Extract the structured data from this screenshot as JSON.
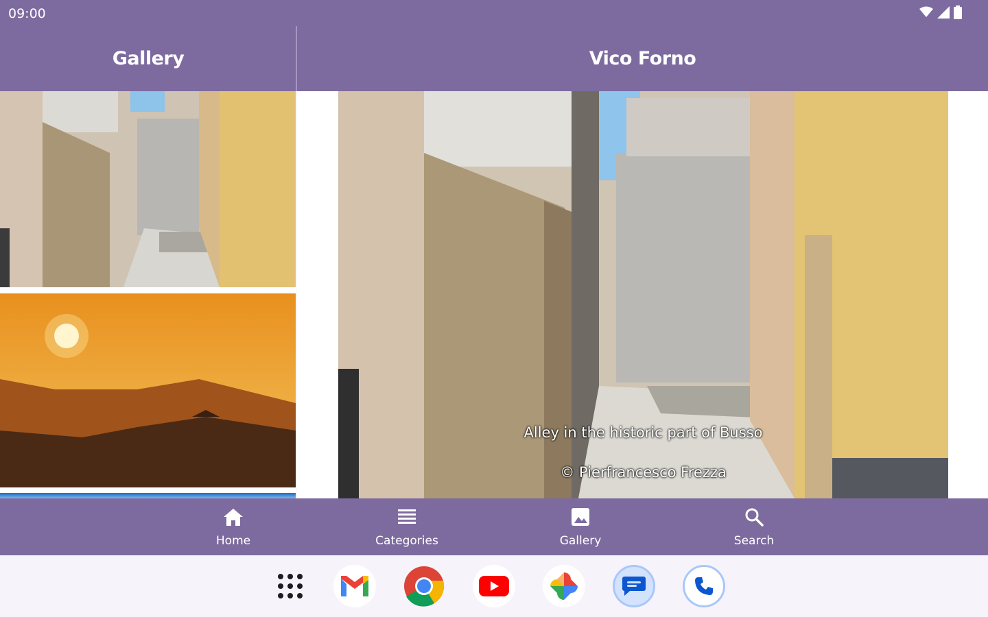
{
  "status": {
    "time": "09:00",
    "icons": [
      "wifi-icon",
      "cell-signal-icon",
      "battery-icon"
    ]
  },
  "list_header": {
    "title": "Gallery"
  },
  "detail_header": {
    "title": "Vico Forno"
  },
  "gallery": {
    "items": [
      {
        "name": "alley-thumbnail"
      },
      {
        "name": "sunset-thumbnail"
      },
      {
        "name": "sky-thumbnail"
      }
    ]
  },
  "detail": {
    "caption": "Alley in the historic part of Busso",
    "credit": "© Pierfrancesco Frezza"
  },
  "bottom_nav": {
    "items": [
      {
        "label": "Home",
        "icon": "home-icon"
      },
      {
        "label": "Categories",
        "icon": "list-icon"
      },
      {
        "label": "Gallery",
        "icon": "image-icon"
      },
      {
        "label": "Search",
        "icon": "search-icon"
      }
    ]
  },
  "dock": {
    "apps": [
      "app-drawer",
      "gmail",
      "chrome",
      "youtube",
      "photos",
      "messages",
      "phone"
    ]
  },
  "colors": {
    "primary": "#7d6b9f",
    "surface": "#f7f3fb"
  }
}
